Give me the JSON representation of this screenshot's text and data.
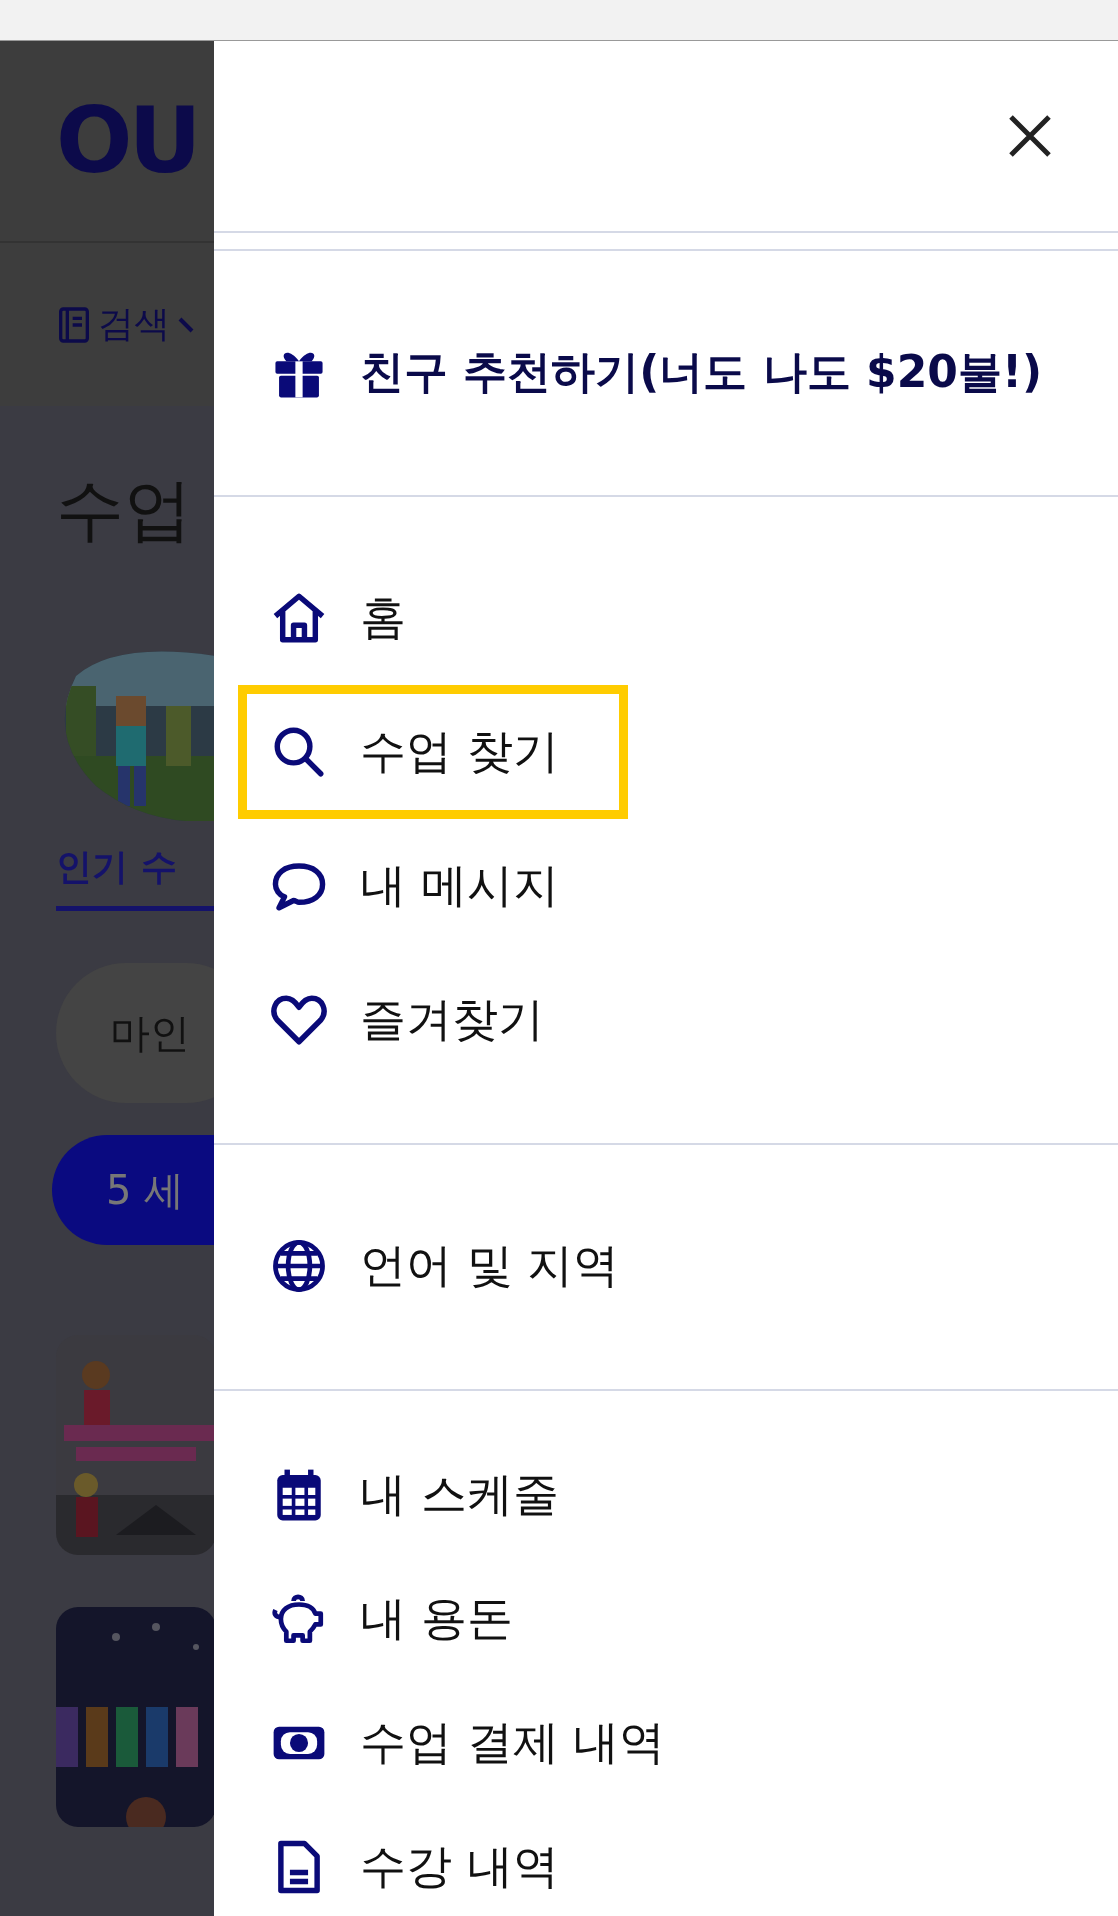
{
  "background_page": {
    "logo": "OU",
    "search_menu": "검색",
    "page_title": "수업",
    "tab": "인기 수",
    "chip": "마인",
    "age_button": "5 세"
  },
  "drawer": {
    "sections": [
      {
        "items": [
          {
            "kind": "promo",
            "label": "친구 추천하기(너도 나도 $20불!)",
            "selected": false
          }
        ]
      },
      {
        "items": [
          {
            "kind": "link",
            "label": "홈",
            "selected": false
          },
          {
            "kind": "link",
            "label": "수업 찾기",
            "selected": true
          },
          {
            "kind": "link",
            "label": "내 메시지",
            "selected": false
          },
          {
            "kind": "link",
            "label": "즐겨찾기",
            "selected": false
          }
        ]
      },
      {
        "items": [
          {
            "kind": "link",
            "label": "언어 및 지역",
            "selected": false
          }
        ]
      },
      {
        "items": [
          {
            "kind": "link",
            "label": "내 스케줄",
            "selected": false
          },
          {
            "kind": "link",
            "label": "내 용돈",
            "selected": false
          },
          {
            "kind": "link",
            "label": "수업 결제 내역",
            "selected": false
          },
          {
            "kind": "link",
            "label": "수강 내역",
            "selected": false
          }
        ]
      }
    ]
  }
}
